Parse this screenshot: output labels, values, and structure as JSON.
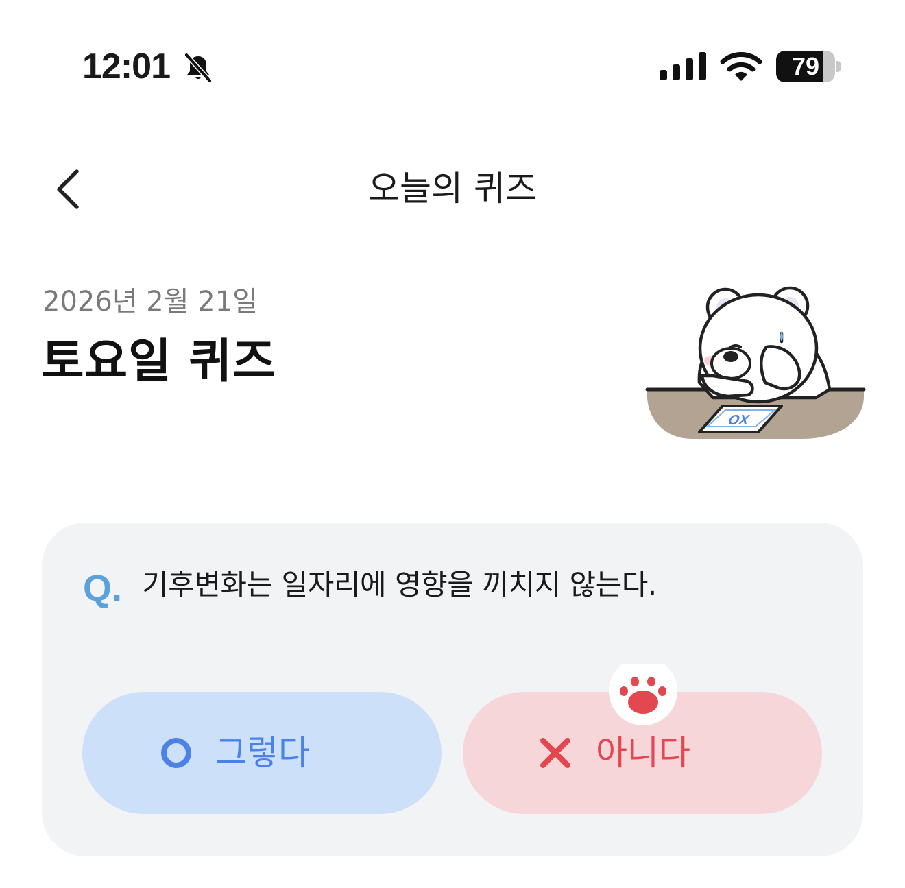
{
  "status_bar": {
    "time": "12:01",
    "battery_percent": "79",
    "battery_level": 0.79
  },
  "nav": {
    "title": "오늘의 퀴즈"
  },
  "header": {
    "date": "2026년 2월 21일",
    "title": "토요일 퀴즈"
  },
  "quiz": {
    "q_mark": "Q.",
    "question": "기후변화는 일자리에 영향을 끼치지 않는다.",
    "answers": [
      {
        "label": "그렇다",
        "icon": "circle-o-icon",
        "color": "#4c82e8",
        "bg": "#cde0fa"
      },
      {
        "label": "아니다",
        "icon": "x-mark-icon",
        "color": "#e3474f",
        "bg": "#f7d6d9"
      }
    ]
  },
  "illustration": {
    "sheet_text": "OX"
  },
  "colors": {
    "q_accent": "#5aa2dd",
    "card_bg": "#f2f3f5",
    "paw": "#e3474f"
  }
}
